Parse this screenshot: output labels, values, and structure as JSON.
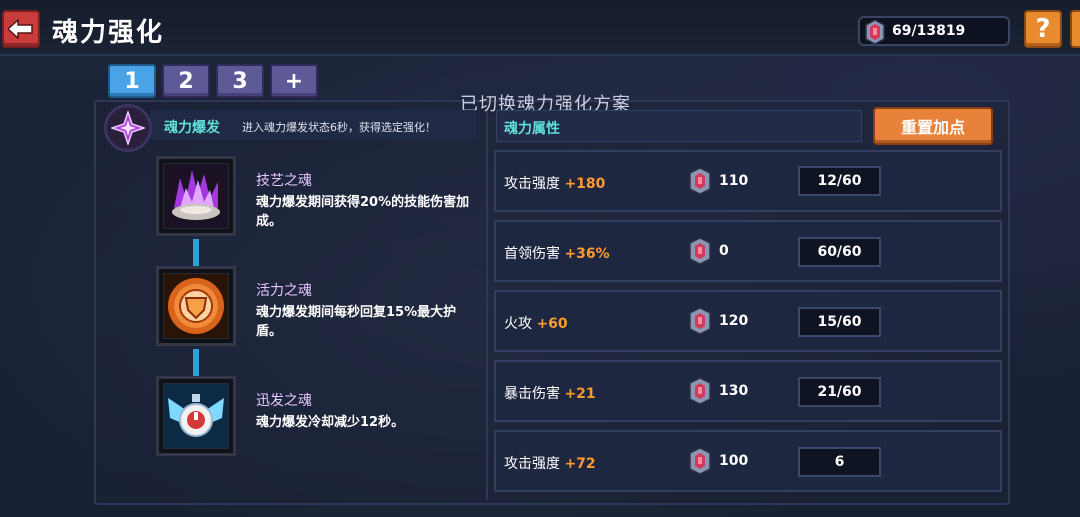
{
  "header": {
    "title": "魂力强化",
    "currency": "69/13819"
  },
  "tabs": [
    "1",
    "2",
    "3",
    "+"
  ],
  "status_message": "已切换魂力强化方案",
  "burst": {
    "title": "魂力爆发",
    "description": "进入魂力爆发状态6秒，获得选定强化！"
  },
  "souls": [
    {
      "name": "技艺之魂",
      "description": "魂力爆发期间获得20%的技能伤害加成。",
      "icon": "purple-crystal-icon"
    },
    {
      "name": "活力之魂",
      "description": "魂力爆发期间每秒回复15%最大护盾。",
      "icon": "shield-emblem-icon"
    },
    {
      "name": "迅发之魂",
      "description": "魂力爆发冷却减少12秒。",
      "icon": "winged-clock-icon"
    }
  ],
  "attributes": {
    "header": "魂力属性",
    "reset_label": "重置加点",
    "rows": [
      {
        "name": "攻击强度",
        "bonus": "+180",
        "cost": "110",
        "level": "12/60"
      },
      {
        "name": "首领伤害",
        "bonus": "+36%",
        "cost": "0",
        "level": "60/60"
      },
      {
        "name": "火攻",
        "bonus": "+60",
        "cost": "120",
        "level": "15/60"
      },
      {
        "name": "暴击伤害",
        "bonus": "+21",
        "cost": "130",
        "level": "21/60"
      },
      {
        "name": "攻击强度",
        "bonus": "+72",
        "cost": "100",
        "level": "6"
      }
    ]
  },
  "colors": {
    "accent_cyan": "#5ee0d8",
    "bonus_orange": "#ff9a2e",
    "button_orange": "#e8823a",
    "tab_active": "#4aa3e6",
    "tab_inactive": "#5e5a98",
    "back_red": "#c83c3c"
  }
}
